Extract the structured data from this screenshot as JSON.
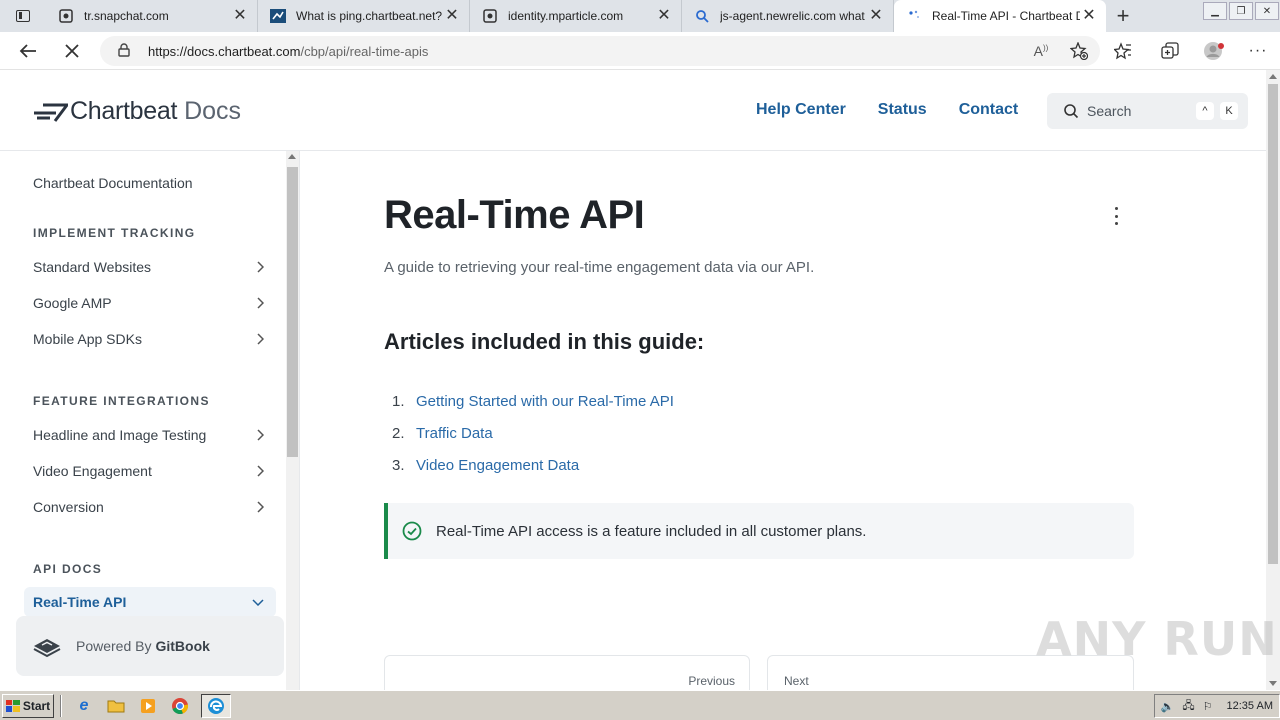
{
  "browser": {
    "tabs": [
      {
        "title": "tr.snapchat.com",
        "active": false
      },
      {
        "title": "What is ping.chartbeat.net?",
        "active": false
      },
      {
        "title": "identity.mparticle.com",
        "active": false
      },
      {
        "title": "js-agent.newrelic.com what",
        "active": false
      },
      {
        "title": "Real-Time API - Chartbeat D",
        "active": true
      }
    ],
    "url_host": "https://docs.chartbeat.com",
    "url_path": "/cbp/api/real-time-apis"
  },
  "site": {
    "brand": "Chartbeat",
    "brand_suffix": "Docs",
    "nav": [
      "Help Center",
      "Status",
      "Contact"
    ],
    "search_placeholder": "Search",
    "search_shortcut": [
      "^",
      "K"
    ]
  },
  "sidebar": {
    "top_item": "Chartbeat Documentation",
    "sections": [
      {
        "heading": "IMPLEMENT TRACKING",
        "items": [
          "Standard Websites",
          "Google AMP",
          "Mobile App SDKs"
        ]
      },
      {
        "heading": "FEATURE INTEGRATIONS",
        "items": [
          "Headline and Image Testing",
          "Video Engagement",
          "Conversion"
        ]
      },
      {
        "heading": "API DOCS",
        "items": [
          "Real-Time API"
        ]
      }
    ],
    "powered_by": "Powered By",
    "powered_brand": "GitBook"
  },
  "main": {
    "title": "Real-Time API",
    "subtitle": "A guide to retrieving your real-time engagement data via our API.",
    "articles_heading": "Articles included in this guide:",
    "articles": [
      {
        "num": "1.",
        "label": "Getting Started with our Real-Time API"
      },
      {
        "num": "2.",
        "label": "Traffic Data"
      },
      {
        "num": "3.",
        "label": "Video Engagement Data"
      }
    ],
    "hint": "Real-Time API access is a feature included in all customer plans.",
    "prev_label": "Previous",
    "next_label": "Next"
  },
  "watermark": "ANY RUN",
  "taskbar": {
    "start": "Start",
    "clock": "12:35 AM"
  },
  "colors": {
    "link": "#2a6aa8",
    "nav": "#1e5f99",
    "hint_accent": "#1a8a4a"
  }
}
